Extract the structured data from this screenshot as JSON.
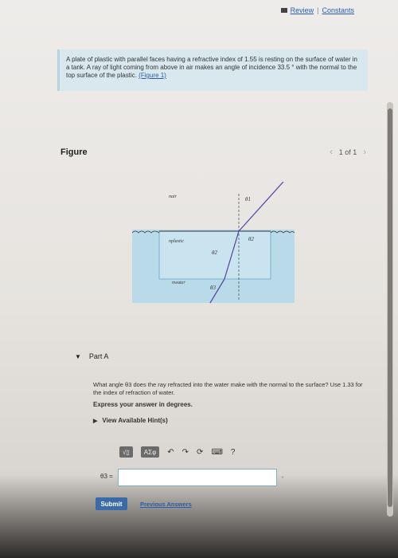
{
  "header": {
    "review": "Review",
    "separator": "|",
    "constants": "Constants"
  },
  "problem": {
    "text": "A plate of plastic with parallel faces having a refractive index of 1.55 is resting on the surface of water in a tank. A ray of light coming from above in air makes an angle of incidence 33.5 ° with the normal to the top surface of the plastic.",
    "figure_link": "(Figure 1)"
  },
  "figure": {
    "title": "Figure",
    "pager": "1 of 1",
    "labels": {
      "air": "nair",
      "plastic": "nplastic",
      "water": "nwater",
      "theta1": "θ1",
      "theta2a": "θ2",
      "theta2b": "θ2",
      "theta3": "θ3"
    }
  },
  "partA": {
    "label": "Part A",
    "question": "What angle θ3 does the ray refracted into the water make with the normal to the surface? Use 1.33 for the index of refraction of water.",
    "express": "Express your answer in degrees.",
    "hints": "View Available Hint(s)",
    "toolbar": {
      "templates": "√▯",
      "symbols": "ΑΣφ",
      "help": "?"
    },
    "answer_label": "θ3 =",
    "answer_value": "",
    "unit": "°",
    "submit": "Submit",
    "previous": "Previous Answers"
  }
}
